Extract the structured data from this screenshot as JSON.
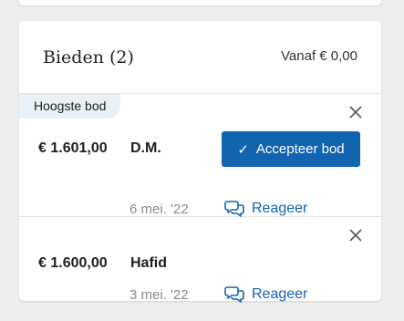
{
  "header": {
    "title": "Bieden (2)",
    "from_price": "Vanaf € 0,00"
  },
  "bids": [
    {
      "badge": "Hoogste bod",
      "amount": "€ 1.601,00",
      "bidder": "D.M.",
      "date": "6 mei. '22",
      "accept_label": "Accepteer bod",
      "reply_label": "Reageer"
    },
    {
      "amount": "€ 1.600,00",
      "bidder": "Hafid",
      "date": "3 mei. '22",
      "reply_label": "Reageer"
    }
  ],
  "icons": {
    "close": "close-icon",
    "check": "check-icon",
    "reply": "chat-bubbles-icon"
  },
  "colors": {
    "primary": "#1264b0",
    "badge_bg": "#e8f0f8",
    "muted_text": "#8a8a8a",
    "background": "#eeeeee"
  }
}
